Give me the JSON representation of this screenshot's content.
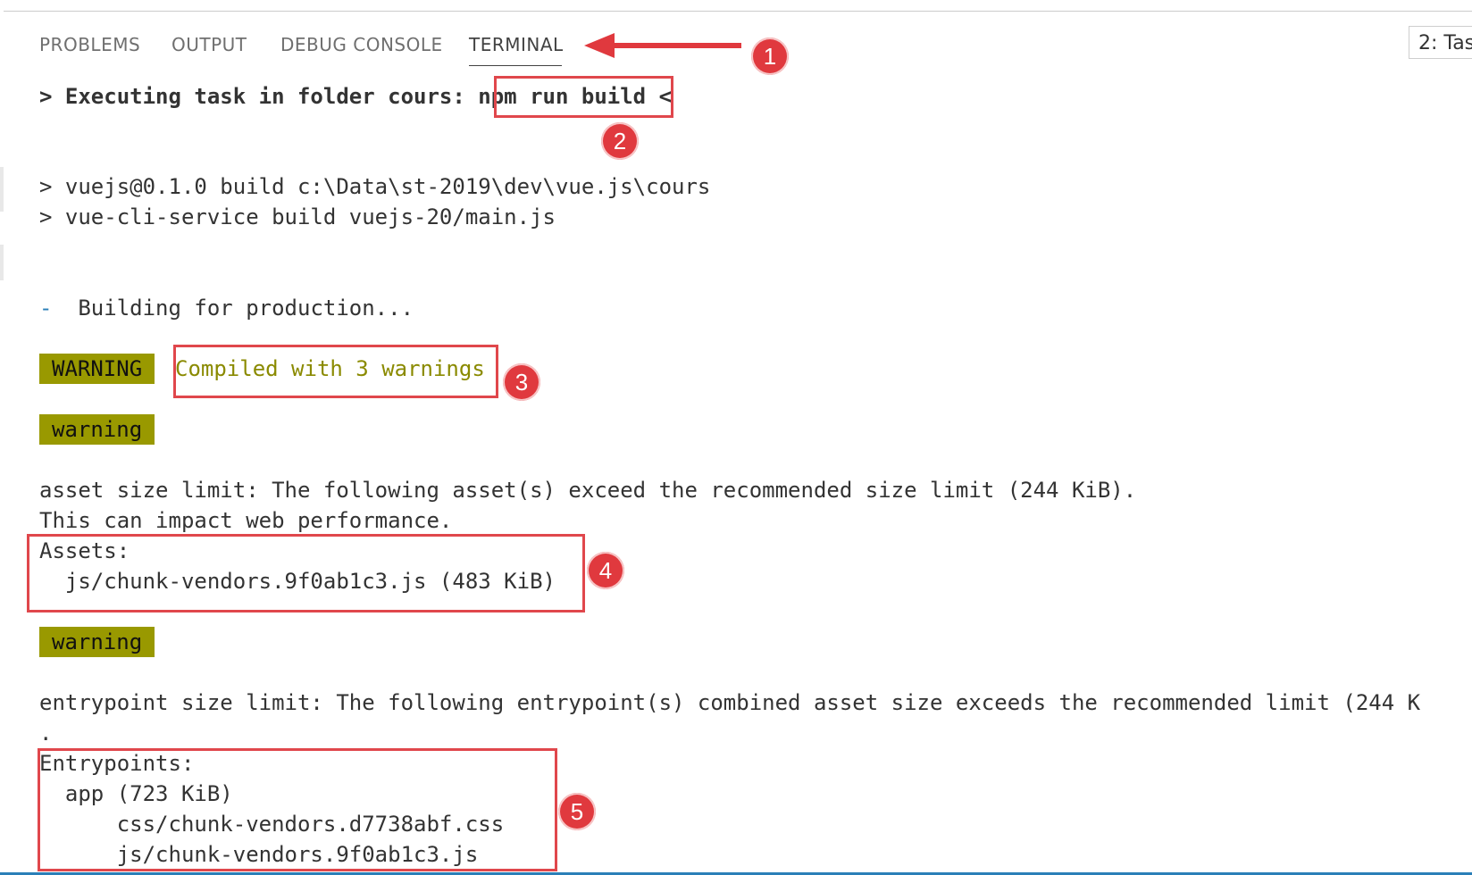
{
  "tabs": [
    {
      "label": "PROBLEMS"
    },
    {
      "label": "OUTPUT"
    },
    {
      "label": "DEBUG CONSOLE"
    },
    {
      "label": "TERMINAL"
    }
  ],
  "task_selector": {
    "value": "2: Tas"
  },
  "terminal": {
    "exec_prefix": "> Executing task in folder cours: ",
    "exec_cmd": "npm run build",
    "exec_suffix": " <",
    "line_build_1": "> vuejs@0.1.0 build c:\\Data\\st-2019\\dev\\vue.js\\cours",
    "line_build_2": "> vue-cli-service build vuejs-20/main.js",
    "building_dash": "-",
    "building_text": "  Building for production...",
    "warning_badge_upper": "WARNING",
    "compiled_text": "Compiled with 3 warnings",
    "warning_badge_lower_1": "warning",
    "asset_line_1": "asset size limit: The following asset(s) exceed the recommended size limit (244 KiB).",
    "asset_line_2": "This can impact web performance.",
    "assets_header": "Assets:",
    "asset_item": "  js/chunk-vendors.9f0ab1c3.js (483 KiB)",
    "warning_badge_lower_2": "warning",
    "entry_line_1": "entrypoint size limit: The following entrypoint(s) combined asset size exceeds the recommended limit (244 K",
    "entry_line_2": ".",
    "entry_header": "Entrypoints:",
    "entry_app": "  app (723 KiB)",
    "entry_css": "      css/chunk-vendors.d7738abf.css",
    "entry_js": "      js/chunk-vendors.9f0ab1c3.js"
  },
  "annotations": {
    "badge_1": "1",
    "badge_2": "2",
    "badge_3": "3",
    "badge_4": "4",
    "badge_5": "5",
    "color": "#e0393e"
  }
}
